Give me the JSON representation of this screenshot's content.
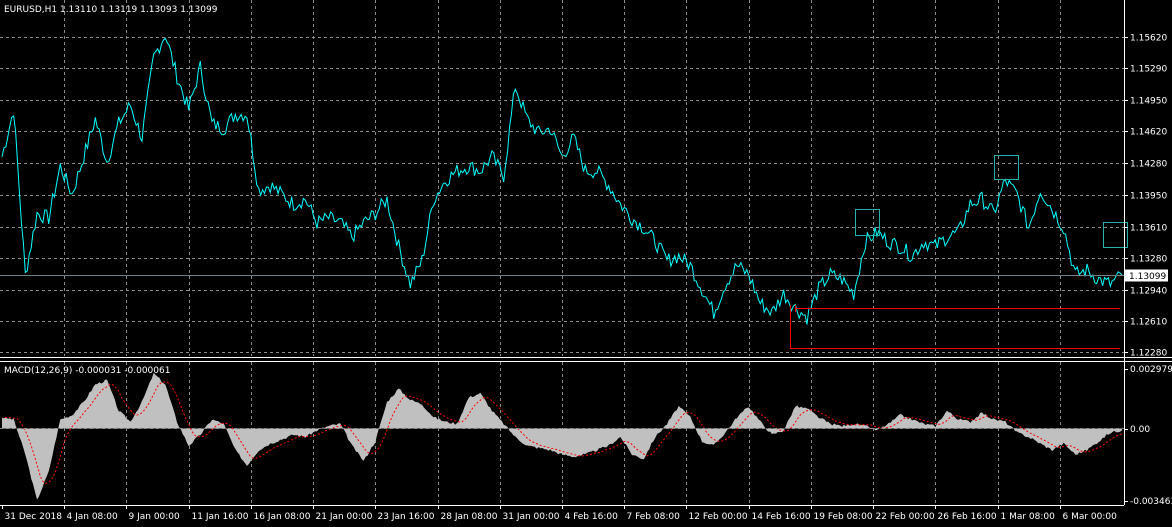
{
  "main_panel": {
    "header": "EURUSD,H1  1.13110 1.13119 1.13093 1.13099",
    "y_ticks": [
      1.1562,
      1.1529,
      1.1495,
      1.1462,
      1.1428,
      1.1395,
      1.1361,
      1.1328,
      1.1294,
      1.1261,
      1.1228
    ],
    "y_tick_labels": [
      "1.15620",
      "1.15290",
      "1.14950",
      "1.14620",
      "1.14280",
      "1.13950",
      "1.13610",
      "1.13280",
      "1.12940",
      "1.12610",
      "1.12280"
    ],
    "current_price": 1.13099,
    "current_price_label": "1.13099",
    "ylim": [
      1.1224,
      1.1583
    ]
  },
  "macd_panel": {
    "header": "MACD(12,26,9) -0.000031 -0.000061",
    "y_tick_labels": [
      "0.002979",
      "0.00",
      "-0.003463"
    ],
    "ylim": [
      -0.003463,
      0.002979
    ]
  },
  "x_axis": {
    "labels": [
      "31 Dec 2018",
      "4 Jan 08:00",
      "9 Jan 00:00",
      "11 Jan 16:00",
      "16 Jan 08:00",
      "21 Jan 00:00",
      "23 Jan 16:00",
      "28 Jan 08:00",
      "31 Jan 00:00",
      "4 Feb 16:00",
      "7 Feb 08:00",
      "12 Feb 00:00",
      "14 Feb 16:00",
      "19 Feb 08:00",
      "22 Feb 00:00",
      "26 Feb 16:00",
      "1 Mar 08:00",
      "6 Mar 00:00"
    ]
  },
  "colors": {
    "background": "#000000",
    "grid": "#8c8c8c",
    "price_line": "#00ffff",
    "histogram": "#c0c0c0",
    "signal": "#ff0000",
    "current_price_line": "#708090",
    "annotation_box": "#20b2aa",
    "support_line": "#ff0000",
    "axis_text": "#ffffff"
  },
  "chart_data": [
    {
      "type": "line",
      "title": "EURUSD,H1  1.13110 1.13119 1.13093 1.13099",
      "x_labels": [
        "31 Dec 2018",
        "4 Jan 08:00",
        "9 Jan 00:00",
        "11 Jan 16:00",
        "16 Jan 08:00",
        "21 Jan 00:00",
        "23 Jan 16:00",
        "28 Jan 08:00",
        "31 Jan 00:00",
        "4 Feb 16:00",
        "7 Feb 08:00",
        "12 Feb 00:00",
        "14 Feb 16:00",
        "19 Feb 08:00",
        "22 Feb 00:00",
        "26 Feb 16:00",
        "1 Mar 08:00",
        "6 Mar 00:00"
      ],
      "series": [
        {
          "values": [
            1.1435,
            1.1485,
            1.131,
            1.1375,
            1.137,
            1.1425,
            1.1395,
            1.1435,
            1.1475,
            1.143,
            1.147,
            1.149,
            1.1455,
            1.154,
            1.1565,
            1.152,
            1.1485,
            1.153,
            1.147,
            1.1465,
            1.148,
            1.148,
            1.14,
            1.1405,
            1.1395,
            1.1385,
            1.139,
            1.1365,
            1.137,
            1.1365,
            1.135,
            1.1365,
            1.1375,
            1.139,
            1.134,
            1.13,
            1.1325,
            1.139,
            1.141,
            1.142,
            1.1425,
            1.142,
            1.1435,
            1.1415,
            1.151,
            1.1475,
            1.146,
            1.1465,
            1.1435,
            1.1455,
            1.142,
            1.142,
            1.1405,
            1.1385,
            1.137,
            1.136,
            1.1345,
            1.1325,
            1.133,
            1.132,
            1.1295,
            1.127,
            1.13,
            1.132,
            1.131,
            1.128,
            1.127,
            1.129,
            1.1275,
            1.1265,
            1.1295,
            1.131,
            1.1305,
            1.129,
            1.1345,
            1.1355,
            1.1345,
            1.134,
            1.133,
            1.1345,
            1.134,
            1.135,
            1.1355,
            1.1385,
            1.139,
            1.1375,
            1.141,
            1.1395,
            1.136,
            1.14,
            1.138,
            1.136,
            1.131,
            1.1315,
            1.1305,
            1.13,
            1.131
          ],
          "color": "#00ffff"
        }
      ],
      "ylim": [
        1.1224,
        1.1583
      ],
      "annotations": [
        "1.13099"
      ]
    },
    {
      "type": "bar",
      "title": "MACD(12,26,9) -0.000031 -0.000061",
      "series": [
        {
          "name": "MACD",
          "values": [
            0.0005,
            0.0004,
            -0.0012,
            -0.0033,
            -0.002,
            0.0004,
            0.0006,
            0.0012,
            0.002,
            0.0022,
            0.0008,
            0.0003,
            0.0012,
            0.0025,
            0.002,
            0.0003,
            -0.0008,
            -0.0003,
            0.0004,
            0.0002,
            -0.001,
            -0.0017,
            -0.001,
            -0.0007,
            -0.0005,
            -0.0003,
            -0.0004,
            -0.0001,
            0.0001,
            0.0002,
            -0.0008,
            -0.0015,
            -0.0006,
            0.0012,
            0.0018,
            0.0013,
            0.0011,
            0.0005,
            0.0003,
            0.0002,
            0.0014,
            0.0016,
            0.0008,
            0.0002,
            -0.0004,
            -0.0008,
            -0.0009,
            -0.001,
            -0.0012,
            -0.0013,
            -0.0012,
            -0.001,
            -0.0008,
            -0.0004,
            -0.0012,
            -0.0014,
            -0.0004,
            0.0002,
            0.001,
            0.0005,
            -0.0006,
            -0.0008,
            -0.0002,
            0.0005,
            0.001,
            0.0003,
            -0.0003,
            -0.0001,
            0.001,
            0.0009,
            0.0005,
            0.0002,
            0.0001,
            0.0002,
            0.0001,
            -0.0001,
            0.0002,
            0.0006,
            0.0004,
            0.0002,
            0.0001,
            0.0008,
            0.0004,
            0.0003,
            0.0007,
            0.0004,
            0.0003,
            -0.0002,
            -0.0004,
            -0.0007,
            -0.001,
            -0.0007,
            -0.0012,
            -0.001,
            -0.0006,
            -0.0002,
            -0.0001
          ],
          "color": "#c0c0c0"
        }
      ],
      "ylim": [
        -0.003463,
        0.002979
      ]
    }
  ]
}
